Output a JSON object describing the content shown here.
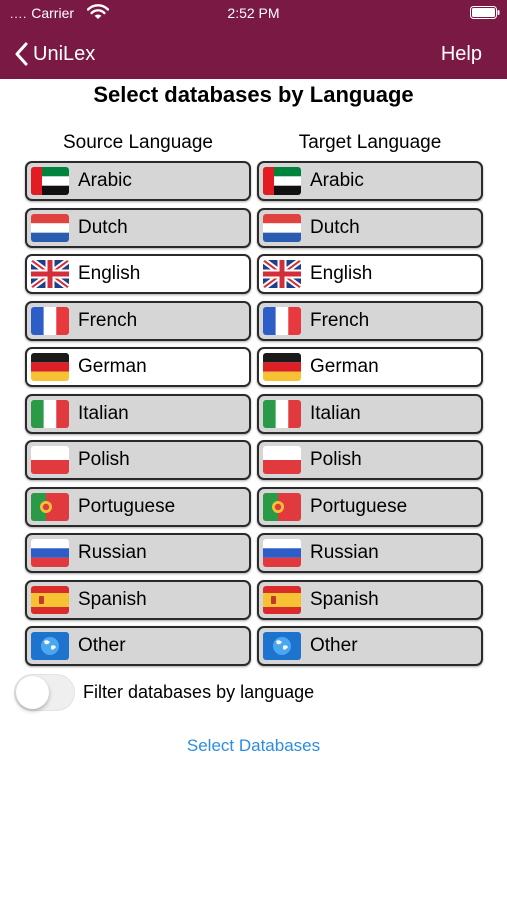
{
  "status_bar": {
    "carrier": "Carrier",
    "time": "2:52 PM",
    "wifi_icon": "wifi-icon",
    "battery_icon": "battery-icon"
  },
  "nav": {
    "back_label": "UniLex",
    "help_label": "Help",
    "background": "#7a1a44"
  },
  "page": {
    "title": "Select databases by Language",
    "source_heading": "Source Language",
    "target_heading": "Target Language"
  },
  "languages": [
    {
      "label": "Arabic",
      "flag": "uae-flag-icon"
    },
    {
      "label": "Dutch",
      "flag": "netherlands-flag-icon"
    },
    {
      "label": "English",
      "flag": "uk-flag-icon"
    },
    {
      "label": "French",
      "flag": "france-flag-icon"
    },
    {
      "label": "German",
      "flag": "germany-flag-icon"
    },
    {
      "label": "Italian",
      "flag": "italy-flag-icon"
    },
    {
      "label": "Polish",
      "flag": "poland-flag-icon"
    },
    {
      "label": "Portuguese",
      "flag": "portugal-flag-icon"
    },
    {
      "label": "Russian",
      "flag": "russia-flag-icon"
    },
    {
      "label": "Spanish",
      "flag": "spain-flag-icon"
    },
    {
      "label": "Other",
      "flag": "globe-icon"
    }
  ],
  "source_selected": [
    "English",
    "German"
  ],
  "target_selected": [
    "English",
    "German"
  ],
  "filter": {
    "label": "Filter databases by language",
    "enabled": false
  },
  "select_databases_label": "Select Databases",
  "colors": {
    "accent": "#2d8ce0",
    "button_unselected": "#d6d6d6",
    "button_selected": "#ffffff"
  }
}
